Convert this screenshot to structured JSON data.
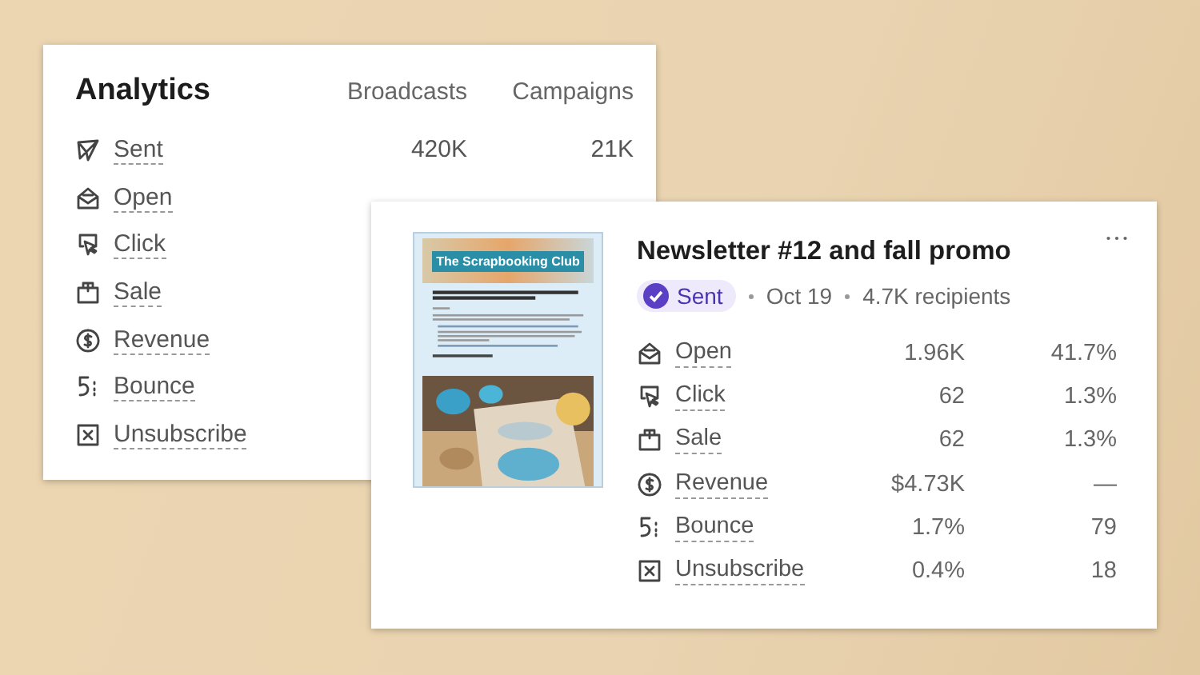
{
  "analytics": {
    "title": "Analytics",
    "columns": [
      "Broadcasts",
      "Campaigns"
    ],
    "rows": [
      {
        "kind": "sent",
        "label": "Sent",
        "values": [
          "420K",
          "21K"
        ]
      },
      {
        "kind": "open",
        "label": "Open"
      },
      {
        "kind": "click",
        "label": "Click"
      },
      {
        "kind": "sale",
        "label": "Sale"
      },
      {
        "kind": "revenue",
        "label": "Revenue"
      },
      {
        "kind": "bounce",
        "label": "Bounce"
      },
      {
        "kind": "unsubscribe",
        "label": "Unsubscribe"
      }
    ]
  },
  "broadcast": {
    "thumbnail": {
      "heading": "The Scrapbooking Club"
    },
    "title": "Newsletter #12 and fall promo",
    "status": "Sent",
    "date": "Oct 19",
    "recipients": "4.7K recipients",
    "rows": [
      {
        "kind": "open",
        "label": "Open",
        "values": [
          "1.96K",
          "41.7%"
        ]
      },
      {
        "kind": "click",
        "label": "Click",
        "values": [
          "62",
          "1.3%"
        ]
      },
      {
        "kind": "sale",
        "label": "Sale",
        "values": [
          "62",
          "1.3%"
        ]
      },
      {
        "kind": "revenue",
        "label": "Revenue",
        "values": [
          "$4.73K",
          "—"
        ]
      },
      {
        "kind": "bounce",
        "label": "Bounce",
        "values": [
          "1.7%",
          "79"
        ]
      },
      {
        "kind": "unsubscribe",
        "label": "Unsubscribe",
        "values": [
          "0.4%",
          "18"
        ]
      }
    ]
  }
}
